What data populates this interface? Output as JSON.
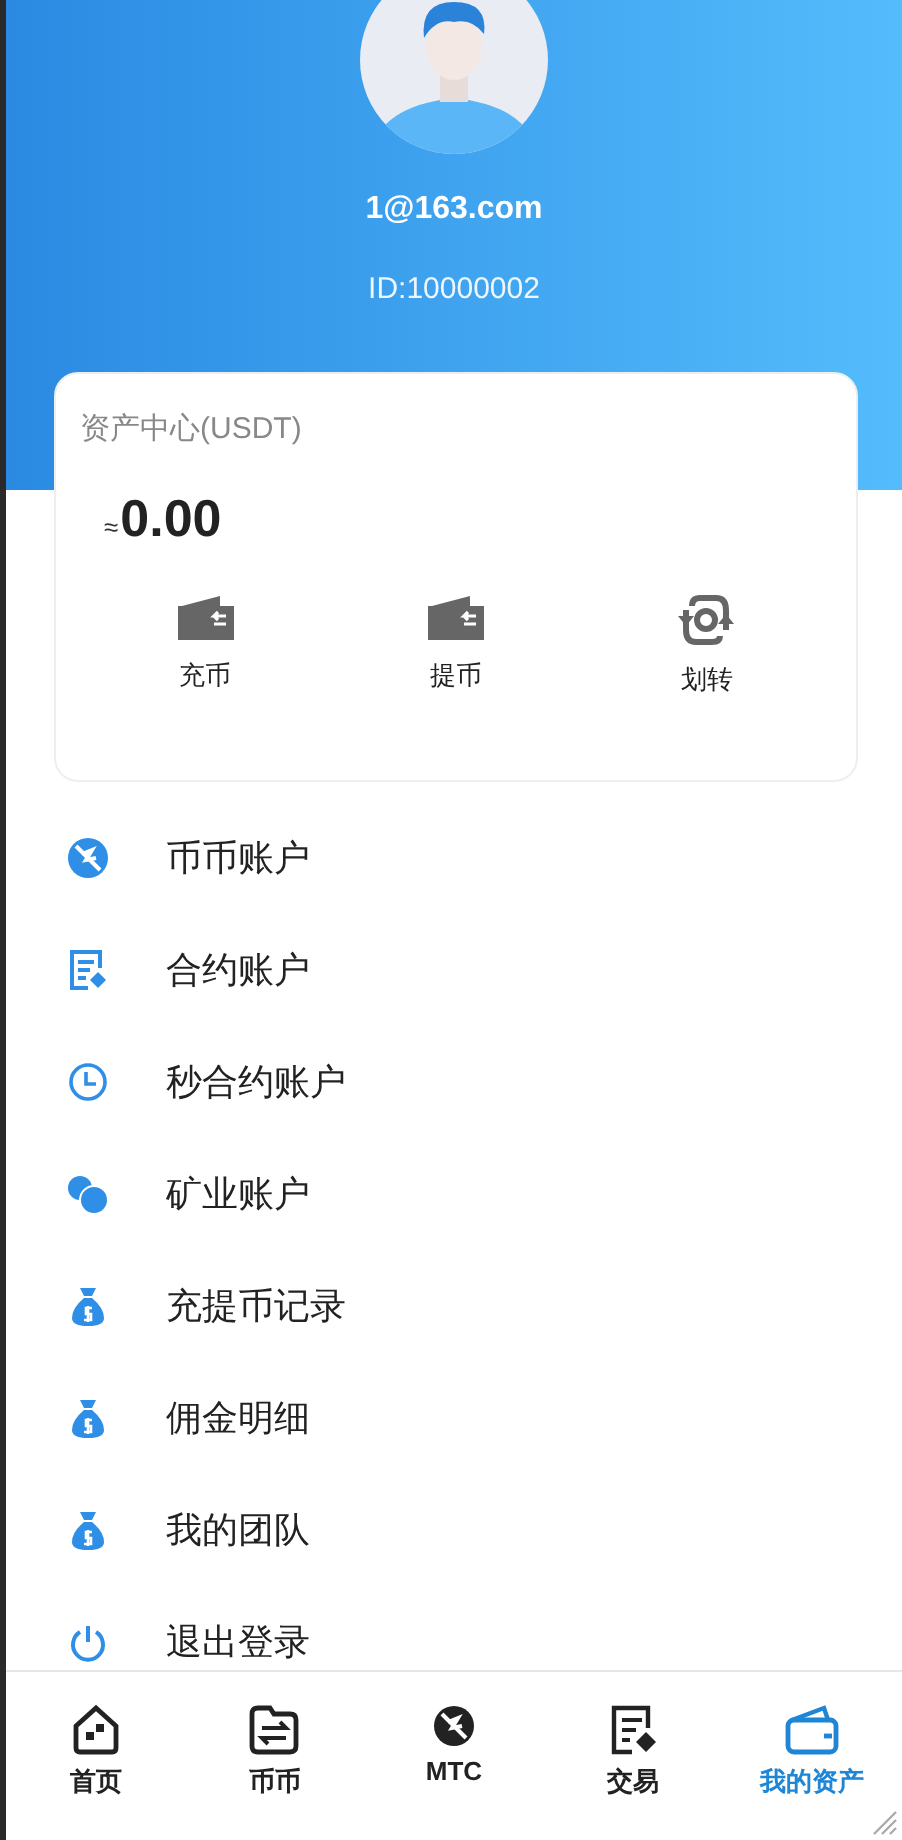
{
  "profile": {
    "email": "1@163.com",
    "id_label": "ID:10000002"
  },
  "asset_card": {
    "title": "资产中心(USDT)",
    "approx": "≈",
    "amount": "0.00",
    "actions": [
      {
        "kind": "deposit",
        "label": "充币"
      },
      {
        "kind": "withdraw",
        "label": "提币"
      },
      {
        "kind": "transfer",
        "label": "划转"
      }
    ]
  },
  "menu": [
    {
      "kind": "coin",
      "label": "币币账户"
    },
    {
      "kind": "contract",
      "label": "合约账户"
    },
    {
      "kind": "clock",
      "label": "秒合约账户"
    },
    {
      "kind": "mining",
      "label": "矿业账户"
    },
    {
      "kind": "moneybag",
      "label": "充提币记录"
    },
    {
      "kind": "moneybag",
      "label": "佣金明细"
    },
    {
      "kind": "moneybag",
      "label": "我的团队"
    },
    {
      "kind": "power",
      "label": "退出登录"
    }
  ],
  "tab_bar": [
    {
      "kind": "home",
      "label": "首页",
      "selected": false
    },
    {
      "kind": "exchange",
      "label": "币币",
      "selected": false
    },
    {
      "kind": "coin",
      "label": "MTC",
      "selected": false
    },
    {
      "kind": "trade",
      "label": "交易",
      "selected": false
    },
    {
      "kind": "wallet",
      "label": "我的资产",
      "selected": true
    }
  ]
}
